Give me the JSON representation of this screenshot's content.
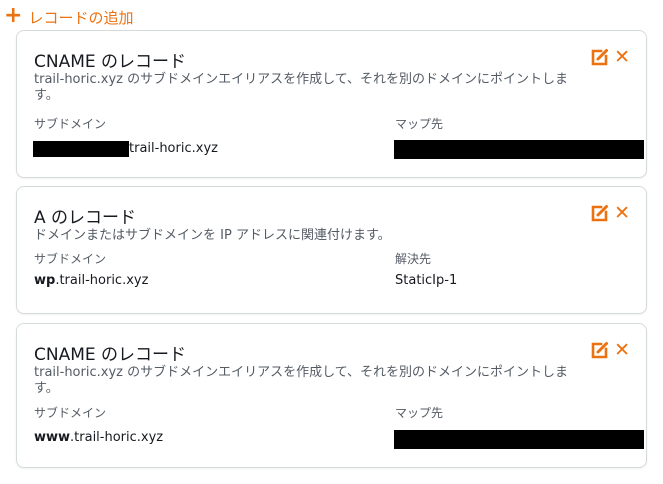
{
  "add_record_label": "レコードの追加",
  "accent_color": "#ec7211",
  "records": [
    {
      "title": "CNAME のレコード",
      "description": "trail-horic.xyz のサブドメインエイリアスを作成して、それを別のドメインにポイントします。",
      "sub_label": "サブドメイン",
      "sub_prefix": "",
      "sub_value": "trail-horic.xyz",
      "target_label": "マップ先",
      "target_value": ""
    },
    {
      "title": "A のレコード",
      "description": "ドメインまたはサブドメインを IP アドレスに関連付けます。",
      "sub_label": "サブドメイン",
      "sub_prefix": "wp",
      "sub_value": ".trail-horic.xyz",
      "target_label": "解決先",
      "target_value": "StaticIp-1"
    },
    {
      "title": "CNAME のレコード",
      "description": "trail-horic.xyz のサブドメインエイリアスを作成して、それを別のドメインにポイントします。",
      "sub_label": "サブドメイン",
      "sub_prefix": "www",
      "sub_value": ".trail-horic.xyz",
      "target_label": "マップ先",
      "target_value": ""
    }
  ]
}
